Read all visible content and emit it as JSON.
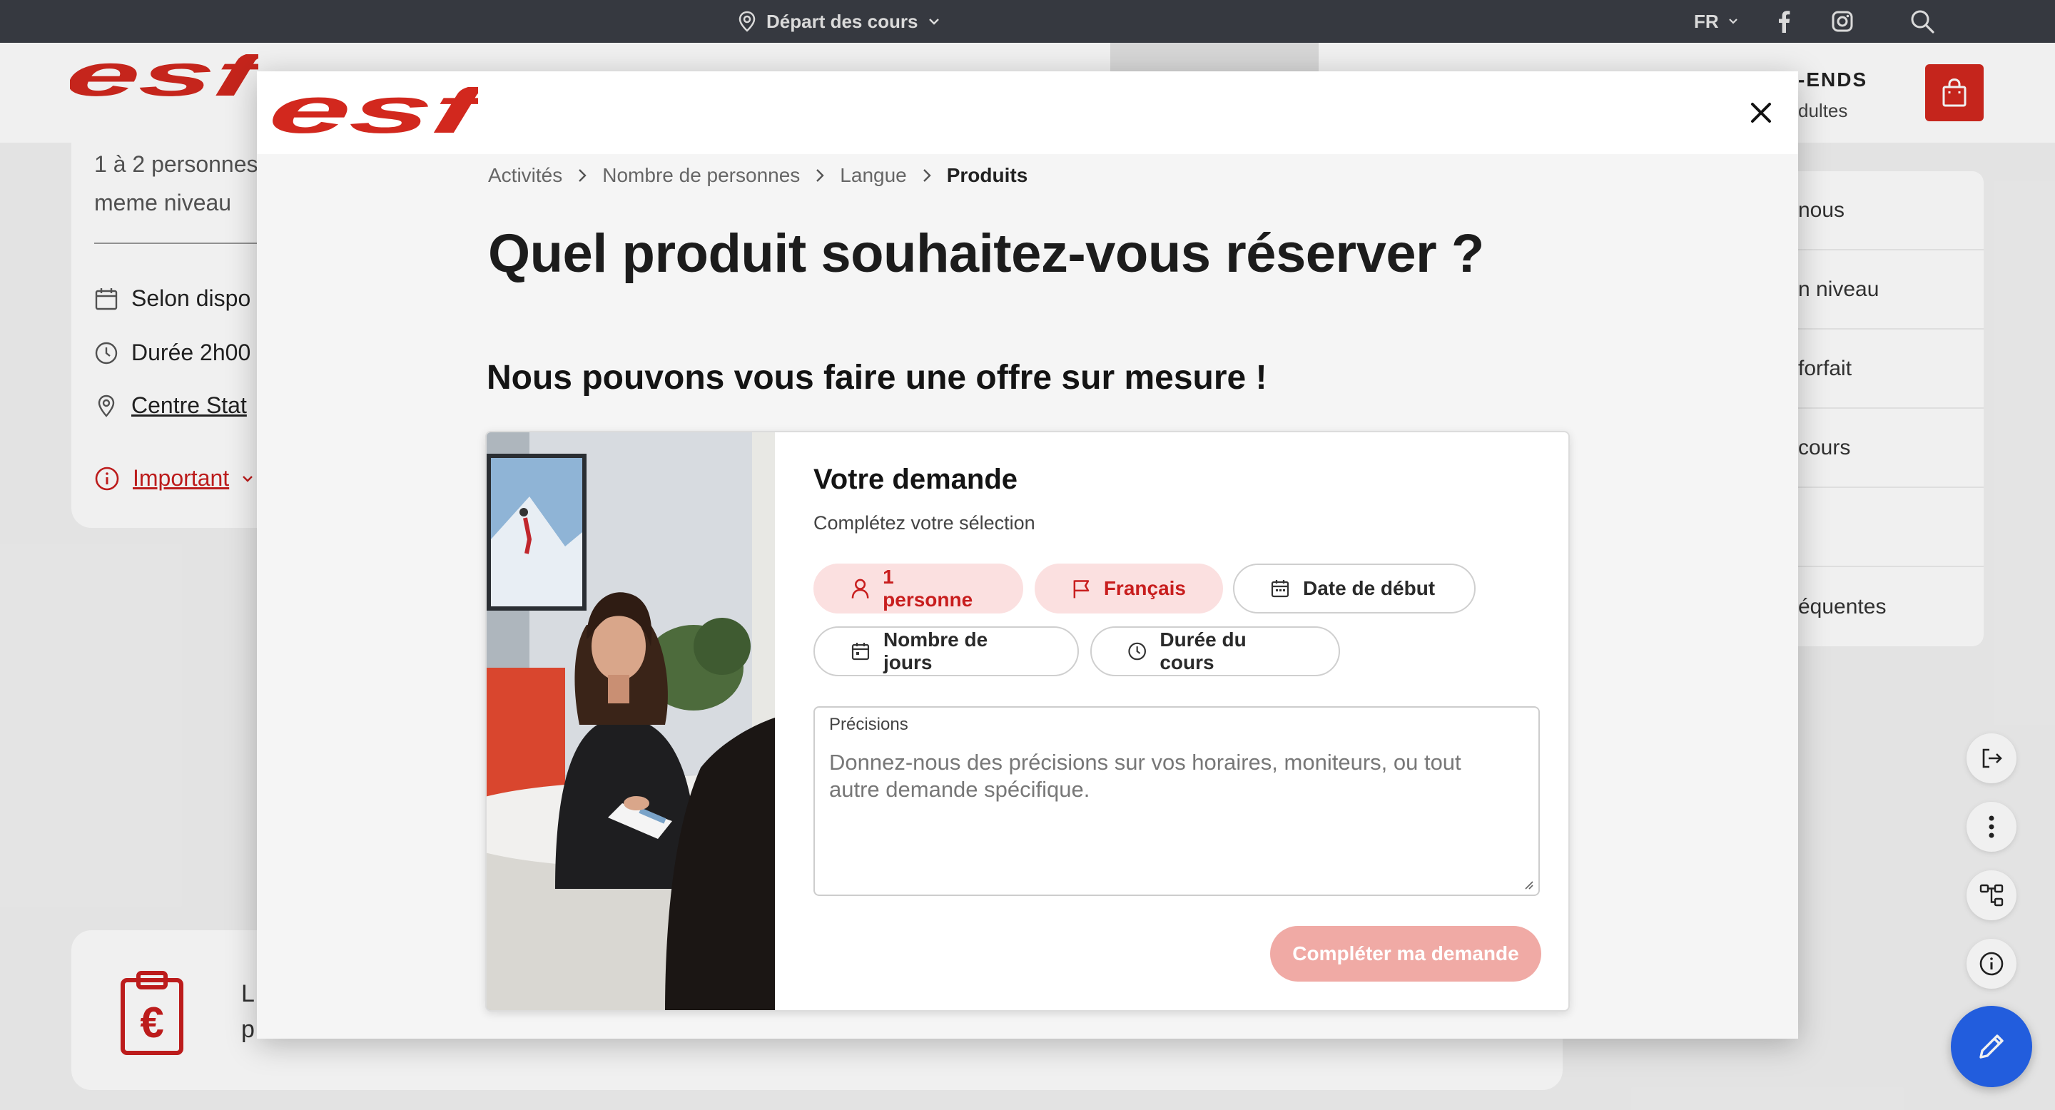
{
  "topbar": {
    "depart_label": "Départ des cours",
    "lang_label": "FR",
    "icons": [
      "location-pin-icon",
      "chevron-down-icon",
      "facebook-icon",
      "instagram-icon",
      "search-icon"
    ]
  },
  "header": {
    "logo_text": "esf",
    "nav_weekends": "-ENDS",
    "nav_adultes": "dultes",
    "brand_color": "#d2281e"
  },
  "background_left": {
    "line1": "1 à 2 personnes",
    "line2": "meme niveau",
    "schedule": "Selon dispo",
    "duration": "Durée 2h00",
    "location": "Centre Stat",
    "important": "Important"
  },
  "background_right": {
    "items": [
      "nous",
      "n niveau",
      "forfait",
      "cours",
      "",
      "équentes"
    ]
  },
  "background_bottom": {
    "line1": "L",
    "line2": "p"
  },
  "modal": {
    "logo_text": "esf",
    "breadcrumb": {
      "items": [
        "Activités",
        "Nombre de personnes",
        "Langue"
      ],
      "current": "Produits"
    },
    "title": "Quel produit souhaitez-vous réserver ?",
    "section_title": "Nous pouvons vous faire une offre sur mesure !",
    "request": {
      "title": "Votre demande",
      "subtitle": "Complétez votre sélection",
      "chips": {
        "persons": "1 personne",
        "language": "Français",
        "start_date": "Date de début",
        "days": "Nombre de jours",
        "duration": "Durée du cours"
      },
      "precisions_label": "Précisions",
      "precisions_placeholder": "Donnez-nous des précisions sur vos horaires, moniteurs, ou tout autre demande spécifique.",
      "submit_label": "Compléter ma demande"
    }
  },
  "colors": {
    "accent_red": "#c81e1e",
    "chip_fill": "#fbe0e0",
    "submit_disabled": "#f0aaa5",
    "fab_blue": "#2563eb"
  }
}
